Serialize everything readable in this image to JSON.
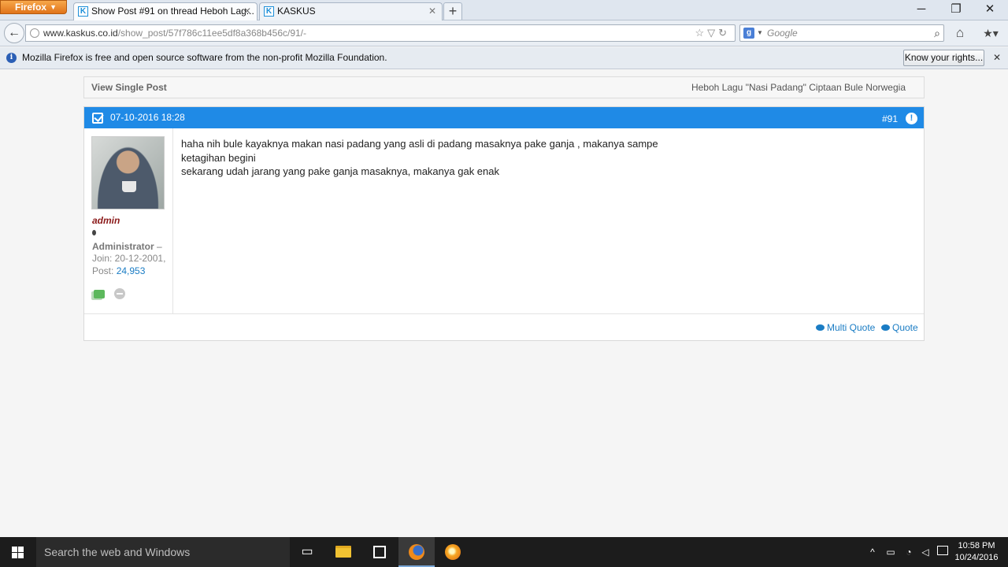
{
  "browser": {
    "app_button": "Firefox",
    "tabs": [
      {
        "label": "Show Post #91 on thread Heboh Lag...",
        "favicon": "K"
      },
      {
        "label": "KASKUS",
        "favicon": "K"
      }
    ],
    "url_host": "www.kaskus.co.id",
    "url_path": "/show_post/57f786c11ee5df8a368b456c/91/-",
    "search_placeholder": "Google",
    "search_engine_letter": "g"
  },
  "notification": {
    "text": "Mozilla Firefox is free and open source software from the non-profit Mozilla Foundation.",
    "button": "Know your rights..."
  },
  "page": {
    "header_left": "View Single Post",
    "header_right": "Heboh Lagu \"Nasi Padang\" Ciptaan Bule Norwegia"
  },
  "post": {
    "date": "07-10-2016 18:28",
    "number": "#91",
    "accent": "#1f8ae6",
    "author": {
      "name": "admin",
      "role": "Administrator",
      "role_sep": "–",
      "join": "Join: 20-12-2001,",
      "post_label": "Post:",
      "post_count": "24,953"
    },
    "lines": [
      "haha nih bule kayaknya makan nasi padang yang asli di padang masaknya pake ganja , makanya sampe",
      "ketagihan begini",
      "sekarang udah jarang yang pake ganja masaknya, makanya gak enak"
    ],
    "actions": {
      "multi_quote": "Multi Quote",
      "quote": "Quote"
    }
  },
  "taskbar": {
    "search_placeholder": "Search the web and Windows",
    "time": "10:58 PM",
    "date": "10/24/2016"
  }
}
